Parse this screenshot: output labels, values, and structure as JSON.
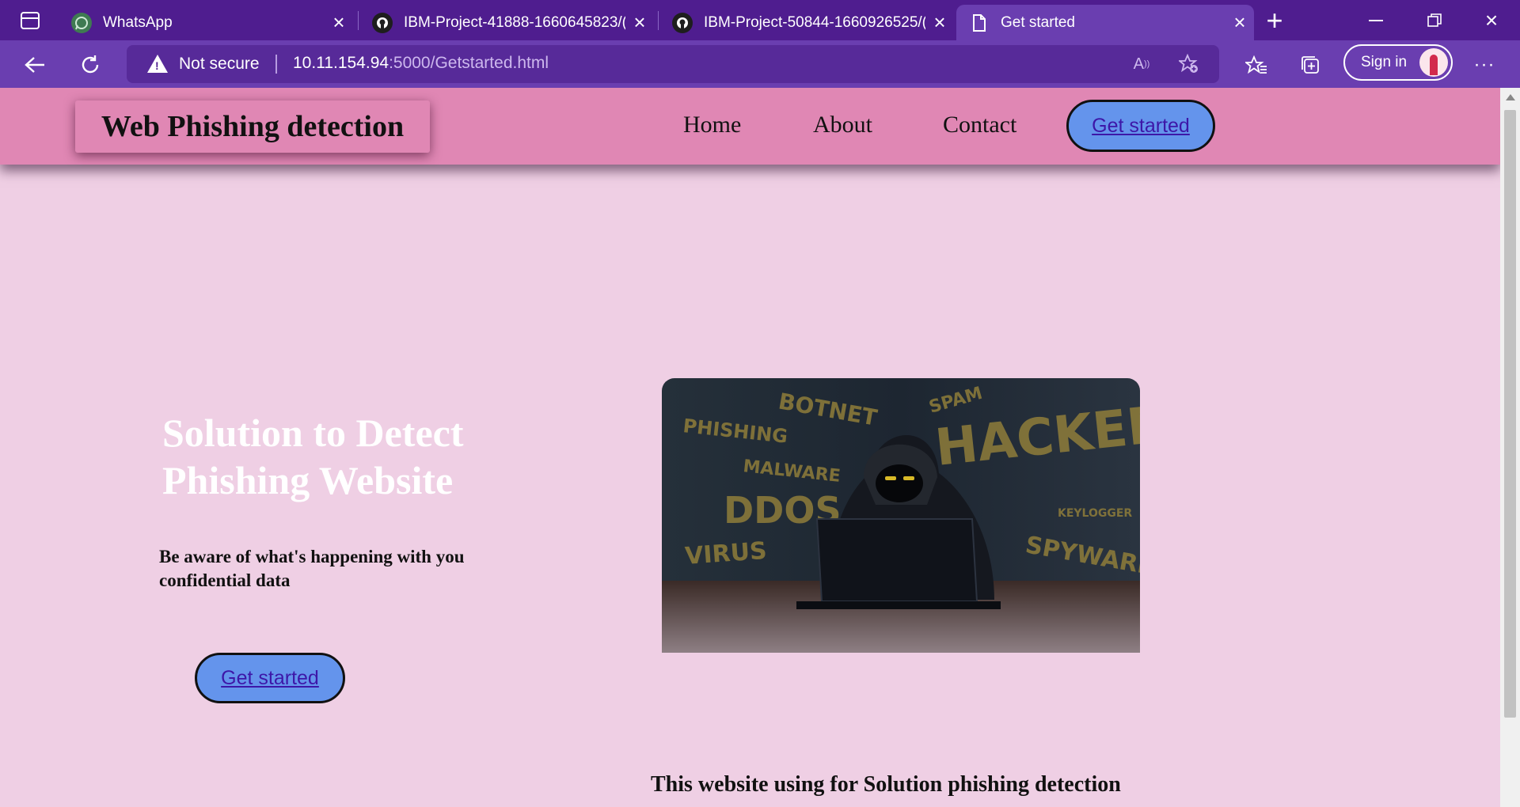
{
  "browser": {
    "tabs": [
      {
        "title": "WhatsApp",
        "icon": "whatsapp-icon"
      },
      {
        "title": "IBM-Project-41888-1660645823/(",
        "icon": "github-icon"
      },
      {
        "title": "IBM-Project-50844-1660926525/(",
        "icon": "github-icon"
      },
      {
        "title": "Get started",
        "icon": "page-icon",
        "active": true
      }
    ],
    "security_label": "Not secure",
    "url_host": "10.11.154.94",
    "url_path": ":5000/Getstarted.html",
    "signin_label": "Sign in",
    "accent": "#4f1d8f"
  },
  "site": {
    "brand": "Web Phishing detection",
    "nav": [
      "Home",
      "About",
      "Contact"
    ],
    "nav_cta": "Get started",
    "hero_title": "Solution to Detect Phishing Website",
    "hero_subtitle": "Be aware of what's happening with you confidential data",
    "hero_cta": "Get started",
    "footer_text": "This website using for Solution phishing detection",
    "image_words": [
      "PHISHING",
      "BOTNET",
      "SPAM",
      "HACKER",
      "MALWARE",
      "DDOS",
      "VIRUS",
      "KEYLOGGER",
      "SPYWARE"
    ],
    "colors": {
      "nav": "#e087b4",
      "page": "#efcfe4",
      "button": "#6494ec"
    }
  }
}
